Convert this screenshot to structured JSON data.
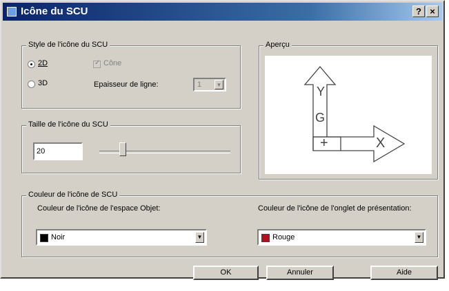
{
  "dialog": {
    "title": "Icône du SCU",
    "help_glyph": "?",
    "close_glyph": "×"
  },
  "style_group": {
    "legend": "Style de l'icône du SCU",
    "radio_2d": "2D",
    "radio_3d": "3D",
    "selected": "2D",
    "cone_label": "Cône",
    "cone_checked": true,
    "cone_enabled": false,
    "thickness_label": "Epaisseur de ligne:",
    "thickness_value": "1"
  },
  "size_group": {
    "legend": "Taille de l'icône du SCU",
    "value": "20"
  },
  "preview_group": {
    "legend": "Aperçu",
    "y_label": "Y",
    "g_label": "G",
    "plus_label": "+",
    "x_label": "X"
  },
  "color_group": {
    "legend": "Couleur de l'icône de SCU",
    "model_label": "Couleur de l'icône de l'espace Objet:",
    "model_value": "Noir",
    "model_swatch": "#000000",
    "layout_label": "Couleur de l'icône de l'onglet de présentation:",
    "layout_value": "Rouge",
    "layout_swatch": "#b01020"
  },
  "buttons": {
    "ok": "OK",
    "cancel": "Annuler",
    "help": "Aide"
  },
  "colors": {
    "title_start": "#0a246a",
    "title_end": "#a6caf0",
    "face": "#d4d0c8"
  }
}
